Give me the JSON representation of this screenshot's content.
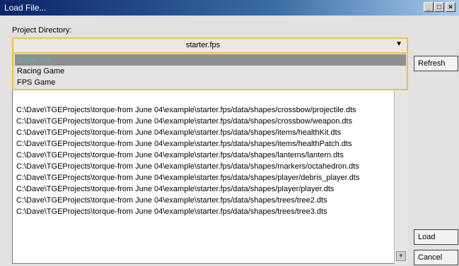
{
  "window": {
    "title": "Load File...",
    "minimize": "_",
    "maximize": "□",
    "close": "×"
  },
  "project": {
    "label": "Project Directory:",
    "selected": "starter.fps",
    "arrow": "▼",
    "options": [
      {
        "label": "starter.fps",
        "selected": true
      },
      {
        "label": "Racing Game",
        "selected": false
      },
      {
        "label": "FPS Game",
        "selected": false
      }
    ]
  },
  "files": [
    "C:\\Dave\\TGEProjects\\torque-from June 04\\example\\starter.fps/data/shapes/crossbow/projectile.dts",
    "C:\\Dave\\TGEProjects\\torque-from June 04\\example\\starter.fps/data/shapes/crossbow/weapon.dts",
    "C:\\Dave\\TGEProjects\\torque-from June 04\\example\\starter.fps/data/shapes/items/healthKit.dts",
    "C:\\Dave\\TGEProjects\\torque-from June 04\\example\\starter.fps/data/shapes/items/healthPatch.dts",
    "C:\\Dave\\TGEProjects\\torque-from June 04\\example\\starter.fps/data/shapes/lanterns/lantern.dts",
    "C:\\Dave\\TGEProjects\\torque-from June 04\\example\\starter.fps/data/shapes/markers/octahedron.dts",
    "C:\\Dave\\TGEProjects\\torque-from June 04\\example\\starter.fps/data/shapes/player/debris_player.dts",
    "C:\\Dave\\TGEProjects\\torque-from June 04\\example\\starter.fps/data/shapes/player/player.dts",
    "C:\\Dave\\TGEProjects\\torque-from June 04\\example\\starter.fps/data/shapes/trees/tree2.dts",
    "C:\\Dave\\TGEProjects\\torque-from June 04\\example\\starter.fps/data/shapes/trees/tree3.dts"
  ],
  "buttons": {
    "refresh": "Refresh",
    "load": "Load",
    "cancel": "Cancel"
  },
  "scroll_down_glyph": "▼",
  "colors": {
    "focus_border": "#f3c233",
    "selected_option_bg": "#8e8e8e",
    "selected_option_text": "#4dbcb0"
  }
}
